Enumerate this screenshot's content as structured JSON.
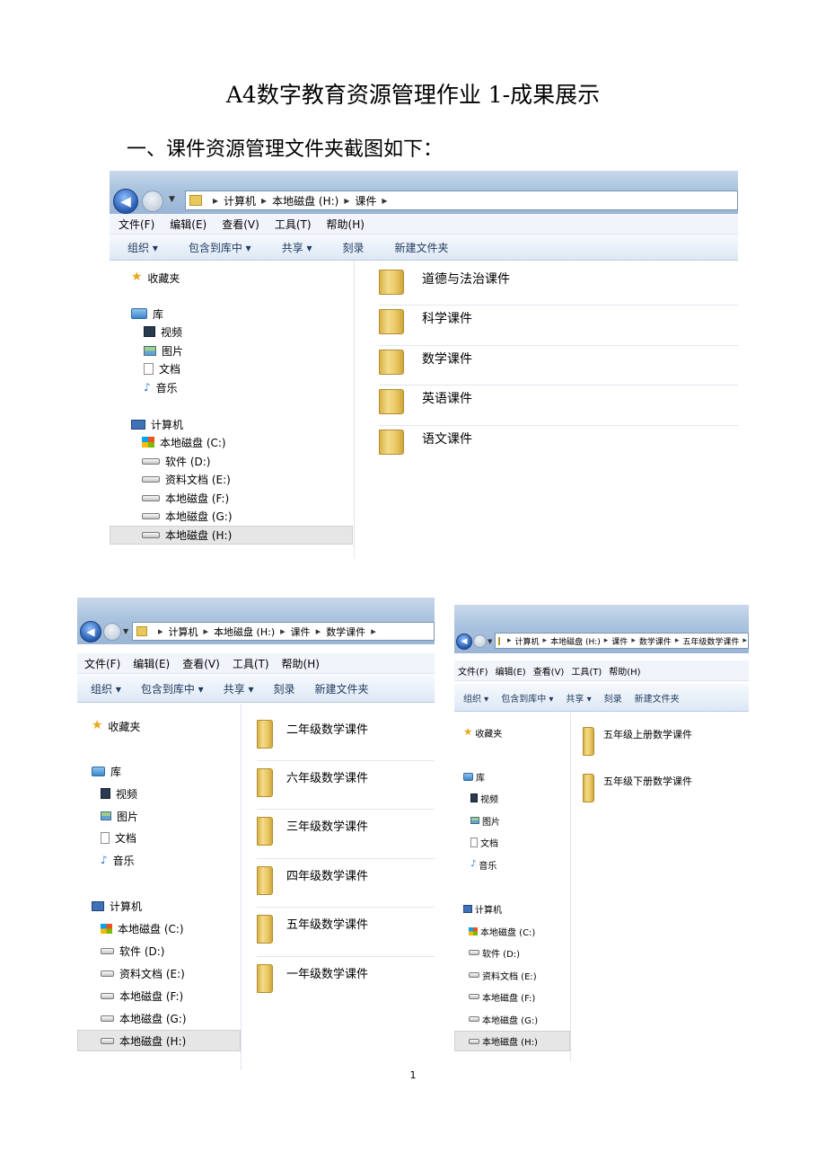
{
  "document": {
    "title": "A4数字教育资源管理作业 1-成果展示",
    "section_heading": "一、课件资源管理文件夹截图如下：",
    "page_number": "1"
  },
  "explorer": {
    "menu": [
      "文件(F)",
      "编辑(E)",
      "查看(V)",
      "工具(T)",
      "帮助(H)"
    ],
    "toolbar": [
      "组织 ▾",
      "包含到库中 ▾",
      "共享 ▾",
      "刻录",
      "新建文件夹"
    ],
    "nav_tree": [
      {
        "label": "收藏夹",
        "icon": "star-icon"
      },
      {
        "label": "库",
        "icon": "library-icon"
      },
      {
        "label": "视频",
        "icon": "video-icon"
      },
      {
        "label": "图片",
        "icon": "picture-icon"
      },
      {
        "label": "文档",
        "icon": "document-icon"
      },
      {
        "label": "音乐",
        "icon": "music-icon"
      },
      {
        "label": "计算机",
        "icon": "computer-icon"
      }
    ],
    "drives": [
      {
        "label": "本地磁盘 (C:)",
        "icon": "windows-drive-icon"
      },
      {
        "label": "软件 (D:)",
        "icon": "drive-icon"
      },
      {
        "label": "资料文档 (E:)",
        "icon": "drive-icon"
      },
      {
        "label": "本地磁盘 (F:)",
        "icon": "drive-icon"
      },
      {
        "label": "本地磁盘 (G:)",
        "icon": "drive-icon"
      },
      {
        "label": "本地磁盘 (H:)",
        "icon": "drive-icon",
        "selected": true
      }
    ]
  },
  "windows": [
    {
      "breadcrumb": [
        "计算机",
        "本地磁盘 (H:)",
        "课件"
      ],
      "folders": [
        "道德与法治课件",
        "科学课件",
        "数学课件",
        "英语课件",
        "语文课件"
      ]
    },
    {
      "breadcrumb": [
        "计算机",
        "本地磁盘 (H:)",
        "课件",
        "数学课件"
      ],
      "folders": [
        "二年级数学课件",
        "六年级数学课件",
        "三年级数学课件",
        "四年级数学课件",
        "五年级数学课件",
        "一年级数学课件"
      ]
    },
    {
      "breadcrumb": [
        "计算机",
        "本地磁盘 (H:)",
        "课件",
        "数学课件",
        "五年级数学课件"
      ],
      "folders": [
        "五年级上册数学课件",
        "五年级下册数学课件"
      ]
    }
  ],
  "colors": {
    "address_bar": "#a9c2de",
    "menubar": "#f1f5fb",
    "toolbar_text": "#1e3a5f",
    "folder": "#e9c764"
  }
}
